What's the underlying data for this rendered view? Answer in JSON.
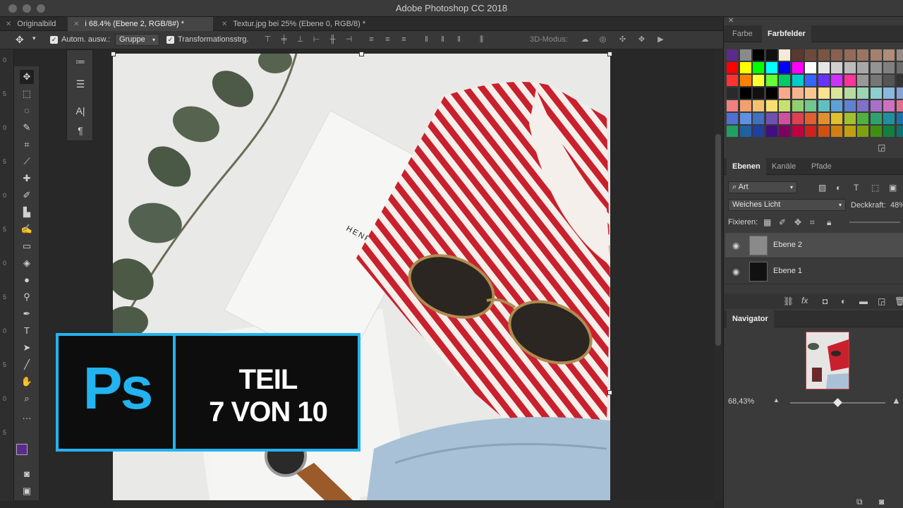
{
  "app": {
    "title": "Adobe Photoshop CC 2018"
  },
  "tabs": [
    {
      "label": "Originalbild"
    },
    {
      "label": "i 68.4% (Ebene 2, RGB/8#) *"
    },
    {
      "label": "Textur.jpg bei 25% (Ebene 0, RGB/8) *"
    }
  ],
  "options": {
    "auto_select_label": "Autom. ausw.:",
    "auto_select_value": "Gruppe",
    "transform_label": "Transformationsstrg.",
    "mode_3d_label": "3D-Modus:"
  },
  "ruler_numbers": [
    "0",
    "5",
    "0",
    "5",
    "0",
    "5",
    "0",
    "5",
    "0",
    "5",
    "0",
    "5"
  ],
  "banner": {
    "logo": "Ps",
    "line1": "TEIL",
    "line2": "7 VON 10"
  },
  "photo": {
    "box_text": "HENRI BENETT"
  },
  "color_panel": {
    "tabs": [
      "Farbe",
      "Farbfelder"
    ],
    "active": "Farbfelder"
  },
  "layers_panel": {
    "tabs": [
      "Ebenen",
      "Kanäle",
      "Pfade"
    ],
    "filter_label": "Art",
    "blend_mode": "Weiches Licht",
    "opacity_label": "Deckkraft:",
    "opacity_value": "48%",
    "lock_label": "Fixieren:",
    "layers": [
      {
        "name": "Ebene 2",
        "selected": true
      },
      {
        "name": "Ebene 1",
        "selected": false
      }
    ]
  },
  "navigator": {
    "title": "Navigator",
    "zoom": "68,43%"
  },
  "colors": {
    "accent": "#23b3f0",
    "foreground": "#5b2a8c",
    "background": "#7a4a3a"
  }
}
